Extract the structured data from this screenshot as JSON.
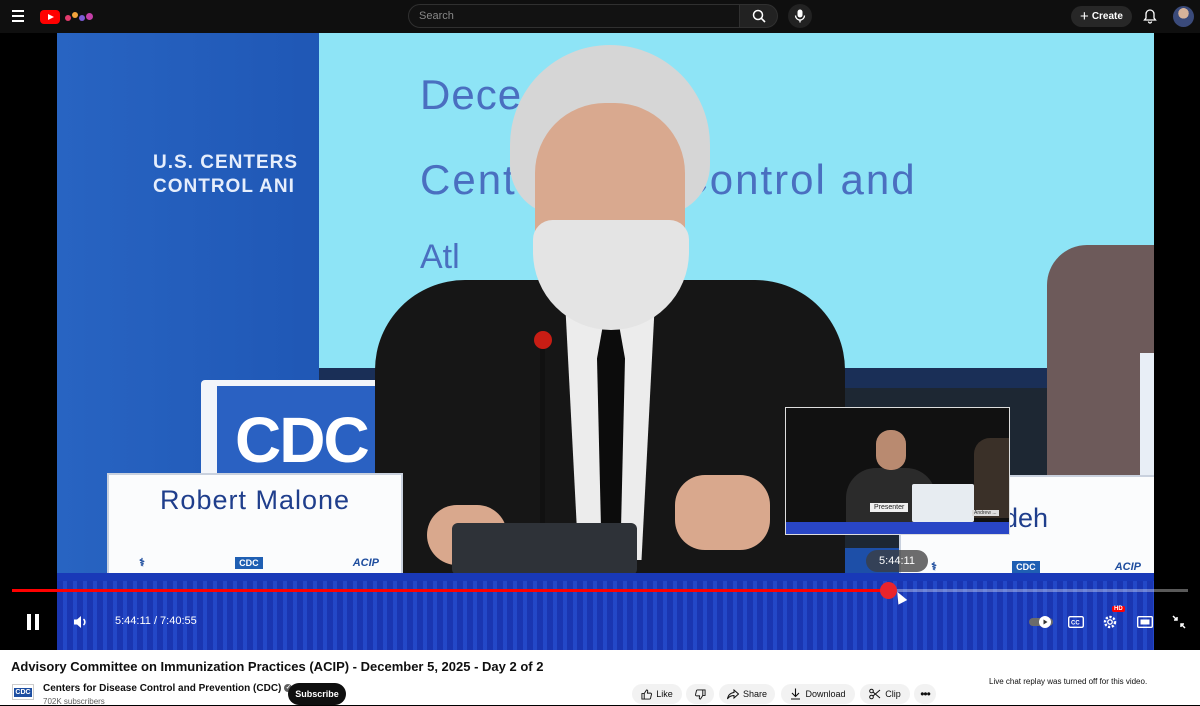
{
  "header": {
    "search_placeholder": "Search",
    "create_label": "Create"
  },
  "player": {
    "current_time": "5:44:11",
    "duration": "7:40:55",
    "time_display": "5:44:11 / 7:40:55",
    "hover_time": "5:44:11",
    "progress_fraction": 0.7446,
    "hd_badge": "HD",
    "accent_color": "#ff0000"
  },
  "video_content": {
    "backdrop_left_line1": "U.S. CENTERS",
    "backdrop_left_line2": "CONTROL ANI",
    "backdrop_cdc": "CDC",
    "screen_line1": "Dece      5, 2025",
    "screen_line2": "Cent        isease Control and",
    "screen_line3": "Atl",
    "nameplate_name": "Robert Malone",
    "nameplate_cdc": "CDC",
    "nameplate_acip": "ACIP",
    "nameplate2_name": "a Zadeh",
    "nameplate2_cdc": "CDC",
    "nameplate2_acip": "ACIP",
    "pip_label": "Presenter",
    "pip_label2": "Andrew ..."
  },
  "video_info": {
    "title": "Advisory Committee on Immunization Practices (ACIP) - December 5, 2025 - Day 2 of 2",
    "channel_logo_text": "CDC",
    "channel_name": "Centers for Disease Control and Prevention (CDC)",
    "subscribers": "702K subscribers",
    "subscribe_label": "Subscribe",
    "actions": {
      "like": "Like",
      "share": "Share",
      "download": "Download",
      "clip": "Clip"
    },
    "chat_note": "Live chat replay was turned off for this video."
  }
}
